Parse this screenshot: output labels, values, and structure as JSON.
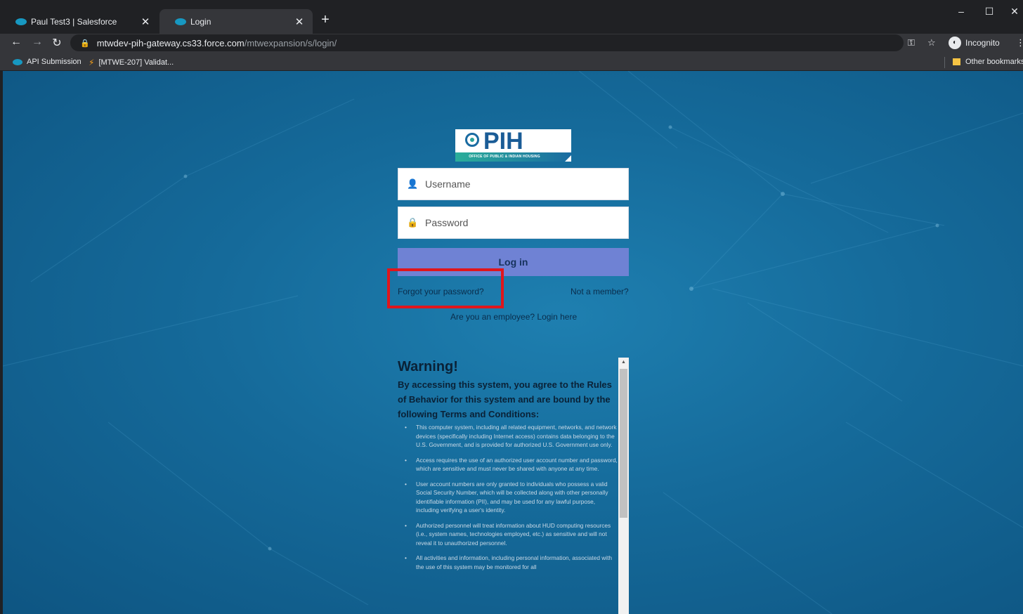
{
  "browser": {
    "tabs": [
      {
        "title": "Paul Test3 | Salesforce",
        "active": false
      },
      {
        "title": "Login",
        "active": true
      }
    ],
    "new_tab": "+",
    "window_controls": {
      "minimize": "–",
      "maximize": "☐",
      "close": "✕"
    },
    "url_host": "mtwdev-pih-gateway.cs33.force.com",
    "url_path": "/mtwexpansion/s/login/",
    "incognito_label": "Incognito",
    "bookmarks": [
      "API Submission",
      "[MTWE-207] Validat..."
    ],
    "other_bookmarks": "Other bookmarks"
  },
  "logo": {
    "text": "PIH",
    "subtitle": "OFFICE OF PUBLIC & INDIAN HOUSING"
  },
  "login": {
    "username_placeholder": "Username",
    "password_placeholder": "Password",
    "button_label": "Log in",
    "forgot_password": "Forgot your password?",
    "not_member": "Not a member?",
    "employee_login": "Are you an employee? Login here"
  },
  "warning": {
    "title": "Warning!",
    "intro": "By accessing this system, you agree to the Rules of Behavior for this system and are bound by the following Terms and Conditions:",
    "items": [
      "This computer system, including all related equipment, networks, and network devices (specifically including Internet access) contains data belonging to the U.S. Government, and is provided for authorized U.S. Government use only.",
      "Access requires the use of an authorized user account number and password, which are sensitive and must never be shared with anyone at any time.",
      "User account numbers are only granted to individuals who possess a valid Social Security Number, which will be collected along with other personally identifiable information (PII), and may be used for any lawful purpose, including verifying a user's identity.",
      "Authorized personnel will treat information about HUD computing resources (i.e., system names, technologies employed, etc.) as sensitive and will not reveal it to unauthorized personnel.",
      "All activities and information, including personal information, associated with the use of this system may be monitored for all"
    ]
  },
  "colors": {
    "page_bg": "#156a9a",
    "login_button": "#6f82d4",
    "highlight": "#e0161c"
  }
}
